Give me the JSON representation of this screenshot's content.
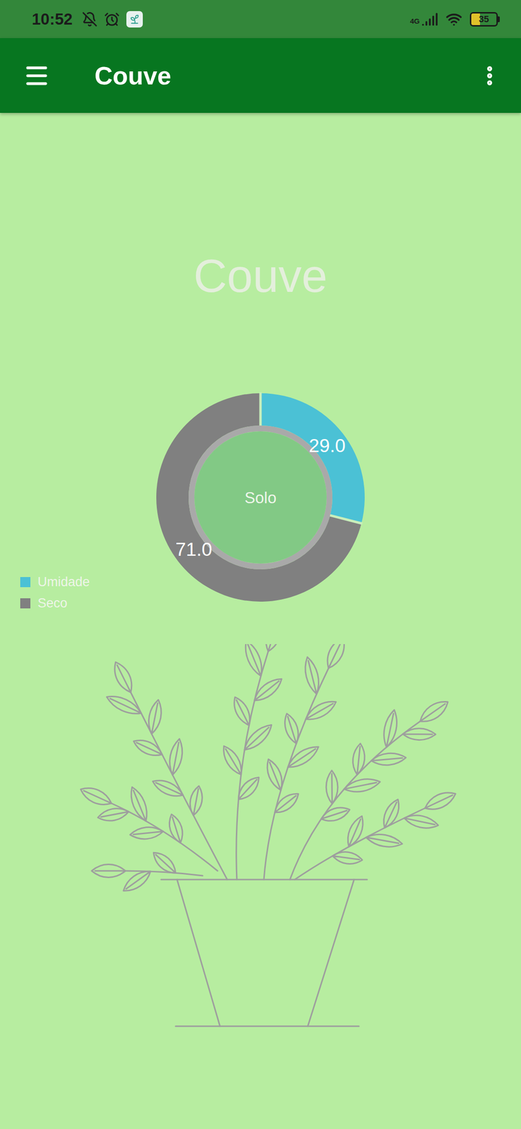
{
  "status_bar": {
    "time": "10:52",
    "network": "4G",
    "battery": {
      "reading": "35",
      "level": 0.35
    }
  },
  "app_bar": {
    "title": "Couve"
  },
  "plant": {
    "name": "Couve"
  },
  "chart": {
    "center_label": "Solo",
    "series": [
      {
        "name": "Umidade",
        "value": 29.0,
        "label": "29.0",
        "color": "#4bc1d5"
      },
      {
        "name": "Seco",
        "value": 71.0,
        "label": "71.0",
        "color": "#808080"
      }
    ]
  }
}
